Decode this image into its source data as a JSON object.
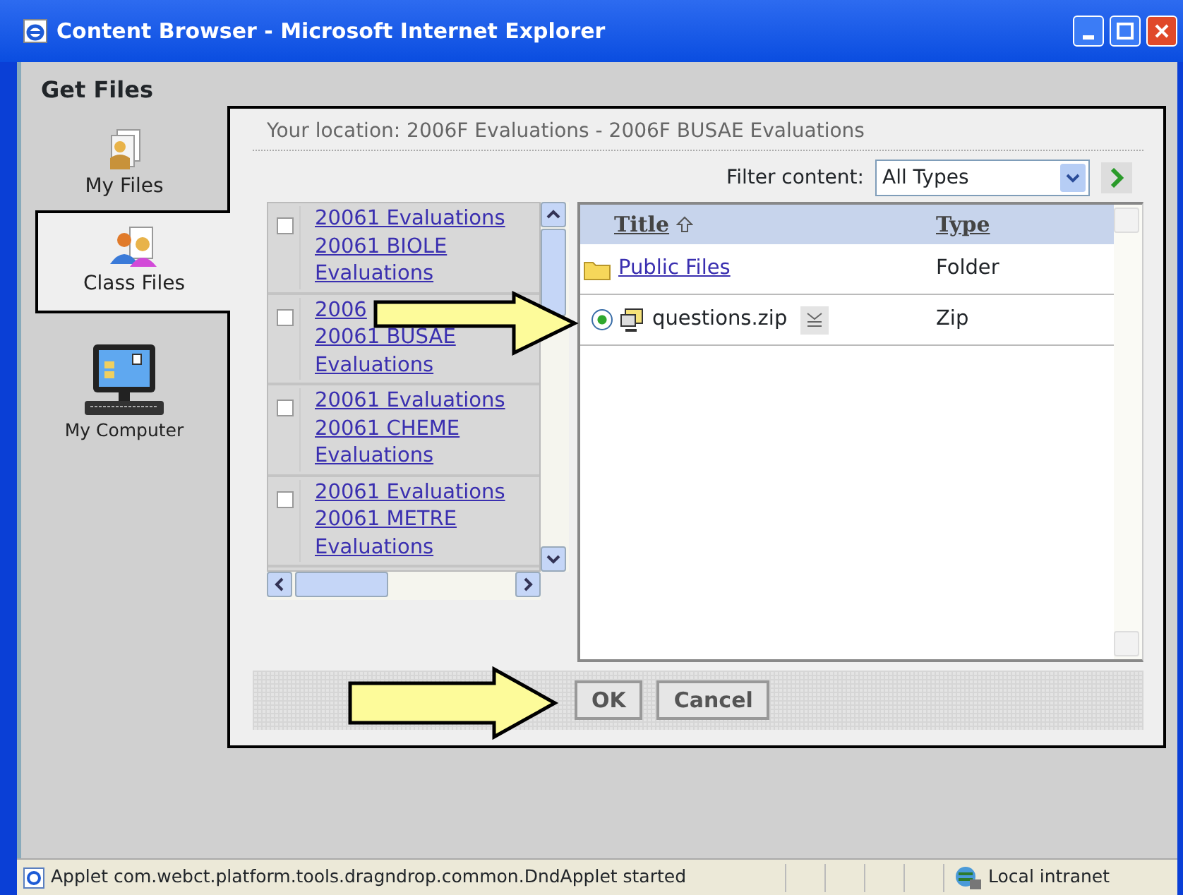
{
  "window": {
    "title": "Content Browser - Microsoft Internet Explorer"
  },
  "heading": "Get Files",
  "tabs": [
    {
      "label": "My Files",
      "kind": "person",
      "selected": false
    },
    {
      "label": "Class Files",
      "kind": "group",
      "selected": true
    },
    {
      "label": "My Computer",
      "kind": "computer",
      "selected": false
    }
  ],
  "location": "Your location: 2006F Evaluations - 2006F BUSAE Evaluations",
  "filter": {
    "label": "Filter content:",
    "value": "All Types"
  },
  "tree": [
    {
      "lines": [
        "20061 Evaluations",
        "20061 BIOLE",
        "Evaluations"
      ],
      "checked": false
    },
    {
      "lines": [
        "2006",
        "20061 BUSAE",
        "Evaluations"
      ],
      "checked": false
    },
    {
      "lines": [
        "20061 Evaluations",
        "20061 CHEME",
        "Evaluations"
      ],
      "checked": false
    },
    {
      "lines": [
        "20061 Evaluations",
        "20061 METRE",
        "Evaluations"
      ],
      "checked": false
    }
  ],
  "table": {
    "columns": [
      "Title",
      "Type"
    ],
    "rows": [
      {
        "kind": "folder",
        "title": "Public Files",
        "type": "Folder",
        "selected": false
      },
      {
        "kind": "file",
        "title": "questions.zip",
        "type": "Zip",
        "selected": true
      }
    ]
  },
  "buttons": [
    "OK",
    "Cancel"
  ],
  "status_bar": {
    "message": "Applet com.webct.platform.tools.dragndrop.common.DndApplet started",
    "zone": "Local intranet"
  }
}
